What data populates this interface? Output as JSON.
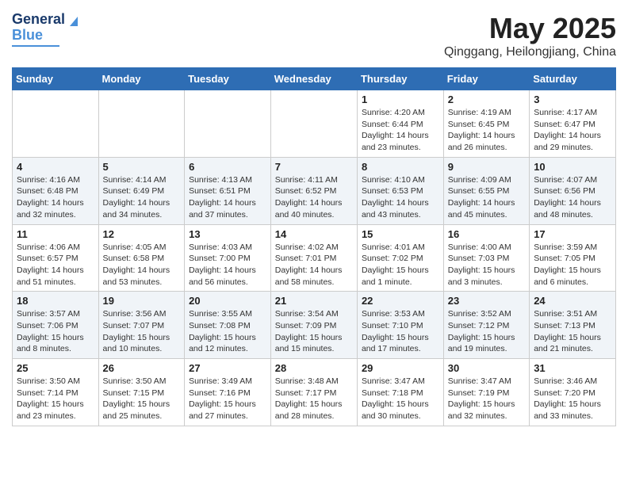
{
  "header": {
    "logo_line1": "General",
    "logo_line2": "Blue",
    "month": "May 2025",
    "location": "Qinggang, Heilongjiang, China"
  },
  "weekdays": [
    "Sunday",
    "Monday",
    "Tuesday",
    "Wednesday",
    "Thursday",
    "Friday",
    "Saturday"
  ],
  "weeks": [
    [
      {
        "day": "",
        "info": ""
      },
      {
        "day": "",
        "info": ""
      },
      {
        "day": "",
        "info": ""
      },
      {
        "day": "",
        "info": ""
      },
      {
        "day": "1",
        "info": "Sunrise: 4:20 AM\nSunset: 6:44 PM\nDaylight: 14 hours\nand 23 minutes."
      },
      {
        "day": "2",
        "info": "Sunrise: 4:19 AM\nSunset: 6:45 PM\nDaylight: 14 hours\nand 26 minutes."
      },
      {
        "day": "3",
        "info": "Sunrise: 4:17 AM\nSunset: 6:47 PM\nDaylight: 14 hours\nand 29 minutes."
      }
    ],
    [
      {
        "day": "4",
        "info": "Sunrise: 4:16 AM\nSunset: 6:48 PM\nDaylight: 14 hours\nand 32 minutes."
      },
      {
        "day": "5",
        "info": "Sunrise: 4:14 AM\nSunset: 6:49 PM\nDaylight: 14 hours\nand 34 minutes."
      },
      {
        "day": "6",
        "info": "Sunrise: 4:13 AM\nSunset: 6:51 PM\nDaylight: 14 hours\nand 37 minutes."
      },
      {
        "day": "7",
        "info": "Sunrise: 4:11 AM\nSunset: 6:52 PM\nDaylight: 14 hours\nand 40 minutes."
      },
      {
        "day": "8",
        "info": "Sunrise: 4:10 AM\nSunset: 6:53 PM\nDaylight: 14 hours\nand 43 minutes."
      },
      {
        "day": "9",
        "info": "Sunrise: 4:09 AM\nSunset: 6:55 PM\nDaylight: 14 hours\nand 45 minutes."
      },
      {
        "day": "10",
        "info": "Sunrise: 4:07 AM\nSunset: 6:56 PM\nDaylight: 14 hours\nand 48 minutes."
      }
    ],
    [
      {
        "day": "11",
        "info": "Sunrise: 4:06 AM\nSunset: 6:57 PM\nDaylight: 14 hours\nand 51 minutes."
      },
      {
        "day": "12",
        "info": "Sunrise: 4:05 AM\nSunset: 6:58 PM\nDaylight: 14 hours\nand 53 minutes."
      },
      {
        "day": "13",
        "info": "Sunrise: 4:03 AM\nSunset: 7:00 PM\nDaylight: 14 hours\nand 56 minutes."
      },
      {
        "day": "14",
        "info": "Sunrise: 4:02 AM\nSunset: 7:01 PM\nDaylight: 14 hours\nand 58 minutes."
      },
      {
        "day": "15",
        "info": "Sunrise: 4:01 AM\nSunset: 7:02 PM\nDaylight: 15 hours\nand 1 minute."
      },
      {
        "day": "16",
        "info": "Sunrise: 4:00 AM\nSunset: 7:03 PM\nDaylight: 15 hours\nand 3 minutes."
      },
      {
        "day": "17",
        "info": "Sunrise: 3:59 AM\nSunset: 7:05 PM\nDaylight: 15 hours\nand 6 minutes."
      }
    ],
    [
      {
        "day": "18",
        "info": "Sunrise: 3:57 AM\nSunset: 7:06 PM\nDaylight: 15 hours\nand 8 minutes."
      },
      {
        "day": "19",
        "info": "Sunrise: 3:56 AM\nSunset: 7:07 PM\nDaylight: 15 hours\nand 10 minutes."
      },
      {
        "day": "20",
        "info": "Sunrise: 3:55 AM\nSunset: 7:08 PM\nDaylight: 15 hours\nand 12 minutes."
      },
      {
        "day": "21",
        "info": "Sunrise: 3:54 AM\nSunset: 7:09 PM\nDaylight: 15 hours\nand 15 minutes."
      },
      {
        "day": "22",
        "info": "Sunrise: 3:53 AM\nSunset: 7:10 PM\nDaylight: 15 hours\nand 17 minutes."
      },
      {
        "day": "23",
        "info": "Sunrise: 3:52 AM\nSunset: 7:12 PM\nDaylight: 15 hours\nand 19 minutes."
      },
      {
        "day": "24",
        "info": "Sunrise: 3:51 AM\nSunset: 7:13 PM\nDaylight: 15 hours\nand 21 minutes."
      }
    ],
    [
      {
        "day": "25",
        "info": "Sunrise: 3:50 AM\nSunset: 7:14 PM\nDaylight: 15 hours\nand 23 minutes."
      },
      {
        "day": "26",
        "info": "Sunrise: 3:50 AM\nSunset: 7:15 PM\nDaylight: 15 hours\nand 25 minutes."
      },
      {
        "day": "27",
        "info": "Sunrise: 3:49 AM\nSunset: 7:16 PM\nDaylight: 15 hours\nand 27 minutes."
      },
      {
        "day": "28",
        "info": "Sunrise: 3:48 AM\nSunset: 7:17 PM\nDaylight: 15 hours\nand 28 minutes."
      },
      {
        "day": "29",
        "info": "Sunrise: 3:47 AM\nSunset: 7:18 PM\nDaylight: 15 hours\nand 30 minutes."
      },
      {
        "day": "30",
        "info": "Sunrise: 3:47 AM\nSunset: 7:19 PM\nDaylight: 15 hours\nand 32 minutes."
      },
      {
        "day": "31",
        "info": "Sunrise: 3:46 AM\nSunset: 7:20 PM\nDaylight: 15 hours\nand 33 minutes."
      }
    ]
  ]
}
